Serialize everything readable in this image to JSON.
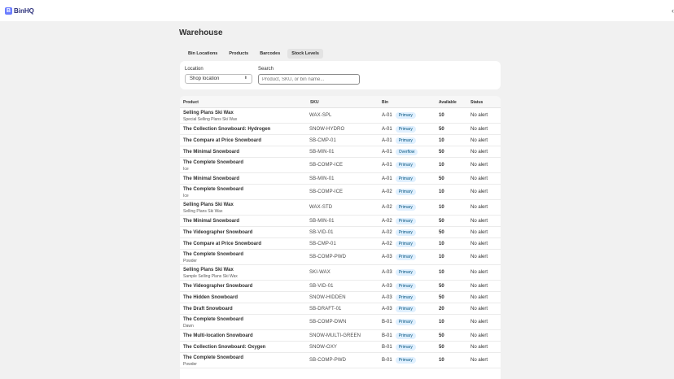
{
  "app": {
    "logo_text": "BinHQ"
  },
  "page": {
    "title": "Warehouse"
  },
  "tabs": [
    "Bin Locations",
    "Products",
    "Barcodes",
    "Stock Levels"
  ],
  "active_tab": 3,
  "filters": {
    "location_label": "Location",
    "location_value": "Shop location",
    "search_label": "Search",
    "search_placeholder": "Product, SKU, or bin name..."
  },
  "table": {
    "headers": {
      "product": "Product",
      "sku": "SKU",
      "bin": "Bin",
      "available": "Available",
      "status": "Status"
    },
    "rows": [
      {
        "name": "Selling Plans Ski Wax",
        "sub": "Special Selling Plans Ski Wax",
        "sku": "WAX-SPL",
        "bin": "A-01",
        "type": "Primary",
        "available": "10",
        "status": "No alert"
      },
      {
        "name": "The Collection Snowboard: Hydrogen",
        "sub": "",
        "sku": "SNOW-HYDRO",
        "bin": "A-01",
        "type": "Primary",
        "available": "50",
        "status": "No alert"
      },
      {
        "name": "The Compare at Price Snowboard",
        "sub": "",
        "sku": "SB-CMP-01",
        "bin": "A-01",
        "type": "Primary",
        "available": "10",
        "status": "No alert"
      },
      {
        "name": "The Minimal Snowboard",
        "sub": "",
        "sku": "SB-MIN-01",
        "bin": "A-01",
        "type": "Overflow",
        "available": "50",
        "status": "No alert"
      },
      {
        "name": "The Complete Snowboard",
        "sub": "Ice",
        "sku": "SB-COMP-ICE",
        "bin": "A-01",
        "type": "Primary",
        "available": "10",
        "status": "No alert"
      },
      {
        "name": "The Minimal Snowboard",
        "sub": "",
        "sku": "SB-MIN-01",
        "bin": "A-01",
        "type": "Primary",
        "available": "50",
        "status": "No alert"
      },
      {
        "name": "The Complete Snowboard",
        "sub": "Ice",
        "sku": "SB-COMP-ICE",
        "bin": "A-02",
        "type": "Primary",
        "available": "10",
        "status": "No alert"
      },
      {
        "name": "Selling Plans Ski Wax",
        "sub": "Selling Plans Ski Wax",
        "sku": "WAX-STD",
        "bin": "A-02",
        "type": "Primary",
        "available": "10",
        "status": "No alert"
      },
      {
        "name": "The Minimal Snowboard",
        "sub": "",
        "sku": "SB-MIN-01",
        "bin": "A-02",
        "type": "Primary",
        "available": "50",
        "status": "No alert"
      },
      {
        "name": "The Videographer Snowboard",
        "sub": "",
        "sku": "SB-VID-01",
        "bin": "A-02",
        "type": "Primary",
        "available": "50",
        "status": "No alert"
      },
      {
        "name": "The Compare at Price Snowboard",
        "sub": "",
        "sku": "SB-CMP-01",
        "bin": "A-02",
        "type": "Primary",
        "available": "10",
        "status": "No alert"
      },
      {
        "name": "The Complete Snowboard",
        "sub": "Powder",
        "sku": "SB-COMP-PWD",
        "bin": "A-03",
        "type": "Primary",
        "available": "10",
        "status": "No alert"
      },
      {
        "name": "Selling Plans Ski Wax",
        "sub": "Sample Selling Plans Ski Wax",
        "sku": "SKI-WAX",
        "bin": "A-03",
        "type": "Primary",
        "available": "10",
        "status": "No alert"
      },
      {
        "name": "The Videographer Snowboard",
        "sub": "",
        "sku": "SB-VID-01",
        "bin": "A-03",
        "type": "Primary",
        "available": "50",
        "status": "No alert"
      },
      {
        "name": "The Hidden Snowboard",
        "sub": "",
        "sku": "SNOW-HIDDEN",
        "bin": "A-03",
        "type": "Primary",
        "available": "50",
        "status": "No alert"
      },
      {
        "name": "The Draft Snowboard",
        "sub": "",
        "sku": "SB-DRAFT-01",
        "bin": "A-03",
        "type": "Primary",
        "available": "20",
        "status": "No alert"
      },
      {
        "name": "The Complete Snowboard",
        "sub": "Dawn",
        "sku": "SB-COMP-DWN",
        "bin": "B-01",
        "type": "Primary",
        "available": "10",
        "status": "No alert"
      },
      {
        "name": "The Multi-location Snowboard",
        "sub": "",
        "sku": "SNOW-MULTI-GREEN",
        "bin": "B-01",
        "type": "Primary",
        "available": "50",
        "status": "No alert"
      },
      {
        "name": "The Collection Snowboard: Oxygen",
        "sub": "",
        "sku": "SNOW-OXY",
        "bin": "B-01",
        "type": "Primary",
        "available": "50",
        "status": "No alert"
      },
      {
        "name": "The Complete Snowboard",
        "sub": "Powder",
        "sku": "SB-COMP-PWD",
        "bin": "B-01",
        "type": "Primary",
        "available": "10",
        "status": "No alert"
      }
    ]
  }
}
